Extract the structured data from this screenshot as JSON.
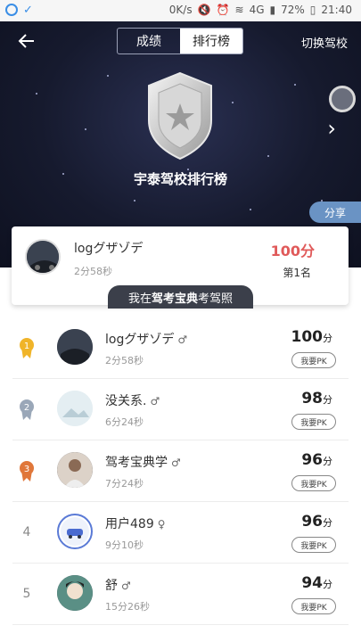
{
  "status_bar": {
    "speed": "0K/s",
    "battery": "72%",
    "time": "21:40",
    "net": "4G"
  },
  "header": {
    "tabs": [
      {
        "label": "成绩"
      },
      {
        "label": "排行榜"
      }
    ],
    "switch_label": "切换驾校"
  },
  "hero": {
    "title": "宇泰驾校排行榜",
    "share_label": "分享"
  },
  "my_card": {
    "name": "logグザゾデ",
    "time": "2分58秒",
    "score": "100分",
    "rank": "第1名"
  },
  "promo": {
    "prefix": "我在",
    "brand": "驾考宝典",
    "suffix": "考驾照"
  },
  "rows": [
    {
      "rank": "1",
      "name": "logグザゾデ",
      "gender": "♂",
      "time": "2分58秒",
      "score": "100",
      "unit": "分",
      "pk": "我要PK"
    },
    {
      "rank": "2",
      "name": "没关系.",
      "gender": "♂",
      "time": "6分24秒",
      "score": "98",
      "unit": "分",
      "pk": "我要PK"
    },
    {
      "rank": "3",
      "name": "驾考宝典学",
      "gender": "♂",
      "time": "7分24秒",
      "score": "96",
      "unit": "分",
      "pk": "我要PK"
    },
    {
      "rank": "4",
      "name": "用户489",
      "gender": "♀",
      "time": "9分10秒",
      "score": "96",
      "unit": "分",
      "pk": "我要PK"
    },
    {
      "rank": "5",
      "name": "舒",
      "gender": "♂",
      "time": "15分26秒",
      "score": "94",
      "unit": "分",
      "pk": "我要PK"
    }
  ],
  "colors": {
    "score_red": "#e05a5a",
    "hero_bg": "#161a2e",
    "gold": "#f0b429",
    "silver": "#9aa7b8",
    "bronze": "#e0773a"
  }
}
